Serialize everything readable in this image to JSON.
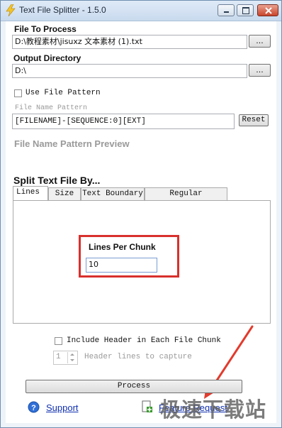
{
  "window": {
    "title": "Text File Splitter - 1.5.0",
    "controls": [
      "minimize",
      "maximize",
      "close"
    ]
  },
  "file_to_process": {
    "label": "File To Process",
    "value": "D:\\教程素材\\jisuxz 文本素材 (1).txt",
    "browse_label": "..."
  },
  "output_directory": {
    "label": "Output Directory",
    "value": "D:\\",
    "browse_label": "..."
  },
  "file_pattern": {
    "checkbox_label": "Use File Pattern",
    "field_label": "File Name Pattern",
    "value": "[FILENAME]-[SEQUENCE:0][EXT]",
    "reset_label": "Reset",
    "preview_label": "File Name Pattern Preview"
  },
  "split": {
    "heading": "Split Text File By...",
    "tabs": [
      "Lines",
      "Size",
      "Text Boundary",
      "Regular Expression"
    ],
    "selected_tab": "Lines",
    "lines_per_chunk_label": "Lines Per Chunk",
    "lines_per_chunk_value": "10"
  },
  "header": {
    "include_label": "Include Header in Each File Chunk",
    "lines_value": "1",
    "lines_label": "Header lines to capture"
  },
  "process_label": "Process",
  "footer": {
    "support_label": "Support",
    "feature_label": "Feature Request"
  },
  "watermark": "极速下载站",
  "colors": {
    "highlight_box": "#d9302c",
    "arrow": "#e23b2d",
    "link": "#1030b0",
    "muted_text": "#9a9a9a"
  }
}
